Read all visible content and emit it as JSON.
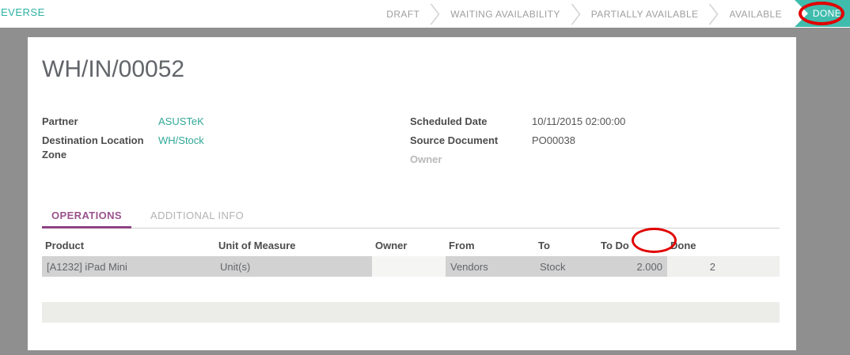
{
  "topbar": {
    "reverse_button": "EVERSE",
    "statusbar": {
      "steps": [
        "DRAFT",
        "WAITING AVAILABILITY",
        "PARTIALLY AVAILABLE",
        "AVAILABLE"
      ],
      "current": "DONE"
    }
  },
  "sheet": {
    "title": "WH/IN/00052",
    "fields_left": {
      "partner_label": "Partner",
      "partner_value": "ASUSTeK",
      "destination_label": "Destination Location Zone",
      "destination_value": "WH/Stock"
    },
    "fields_right": {
      "scheduled_label": "Scheduled Date",
      "scheduled_value": "10/11/2015 02:00:00",
      "source_label": "Source Document",
      "source_value": "PO00038",
      "owner_label": "Owner",
      "owner_value": ""
    },
    "tabs": {
      "operations": "OPERATIONS",
      "additional_info": "ADDITIONAL INFO"
    },
    "table": {
      "headers": [
        "Product",
        "Unit of Measure",
        "Owner",
        "From",
        "To",
        "To Do",
        "Done"
      ],
      "rows": [
        {
          "product": "[A1232] iPad Mini",
          "uom": "Unit(s)",
          "owner": "",
          "from": "Vendors",
          "to": "Stock",
          "todo": "2.000",
          "done": "2"
        }
      ]
    }
  },
  "colors": {
    "teal": "#40bcad",
    "link": "#31a797",
    "purple": "#9a538e",
    "purple_dark": "#8d4383",
    "annotation_red": "#e10000",
    "page_bg": "#8f8f8f"
  }
}
